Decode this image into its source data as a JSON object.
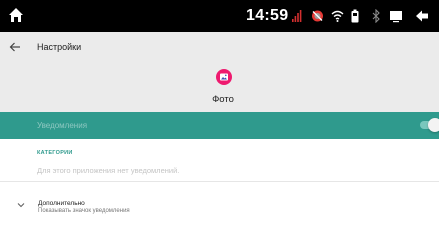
{
  "status_bar": {
    "time": "14:59",
    "icons": [
      "home-icon",
      "signal-bars-icon",
      "notification-muted-icon",
      "wifi-icon",
      "battery-icon",
      "bluetooth-icon",
      "screen-icon",
      "back-icon"
    ],
    "signal_color": "#d32f2f"
  },
  "app_bar": {
    "title": "Настройки",
    "back_icon": "arrow-back-icon",
    "app_name": "Фото",
    "app_icon": "photos-icon",
    "app_icon_color": "#ee1a6f"
  },
  "notifications": {
    "label": "Уведомления",
    "enabled": true,
    "background_color": "#2f9a8d"
  },
  "categories": {
    "header": "КАТЕГОРИИ",
    "empty_text": "Для этого приложения нет уведомлений."
  },
  "advanced": {
    "title": "Дополнительно",
    "summary": "Показывать значок уведомления",
    "icon": "chevron-down-icon"
  }
}
